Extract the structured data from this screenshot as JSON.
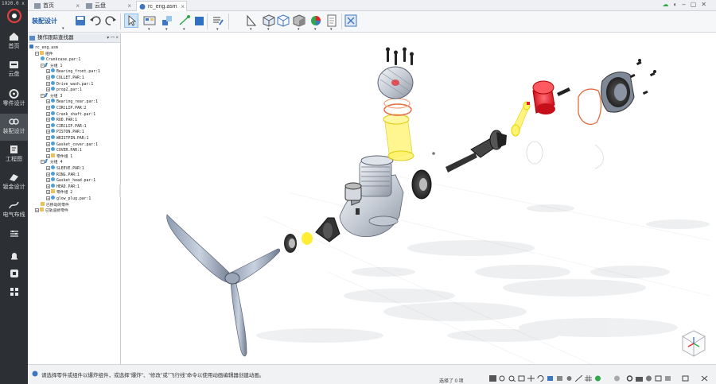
{
  "app": {
    "version": "1920.0 x 10",
    "rail": [
      {
        "label": "首页",
        "icon": "home-icon"
      },
      {
        "label": "云盘",
        "icon": "cloud-drive-icon"
      },
      {
        "label": "零件设计",
        "icon": "gear-icon"
      },
      {
        "label": "装配设计",
        "icon": "assembly-icon"
      },
      {
        "label": "工程图",
        "icon": "drawing-icon"
      },
      {
        "label": "钣金设计",
        "icon": "sheet-metal-icon"
      },
      {
        "label": "电气布线",
        "icon": "wiring-icon"
      }
    ]
  },
  "tabs": [
    {
      "label": "首页"
    },
    {
      "label": "云盘"
    },
    {
      "label": "rc_eng.asm"
    }
  ],
  "ribbon": {
    "mode": "装配设计"
  },
  "panel": {
    "title": "操作跟踪查找器",
    "controls": "▾ ꟷ ×"
  },
  "tree": [
    {
      "label": "rc_eng.asm",
      "depth": 0,
      "icon": "asm",
      "expander": ""
    },
    {
      "label": "组件",
      "depth": 1,
      "icon": "fol",
      "expander": "−"
    },
    {
      "label": "Crankcase.par:1",
      "depth": 2,
      "icon": "part",
      "expander": ""
    },
    {
      "label": "分组 1",
      "depth": 2,
      "icon": "grp",
      "expander": "−"
    },
    {
      "label": "Bearing_front.par:1",
      "depth": 3,
      "icon": "part",
      "expander": "+"
    },
    {
      "label": "COLLET.PAR:1",
      "depth": 3,
      "icon": "part",
      "expander": "+"
    },
    {
      "label": "Drive_wash.par:1",
      "depth": 3,
      "icon": "part",
      "expander": "+"
    },
    {
      "label": "prop2.par:1",
      "depth": 3,
      "icon": "part",
      "expander": "+"
    },
    {
      "label": "分组 3",
      "depth": 2,
      "icon": "grp",
      "expander": "−"
    },
    {
      "label": "Bearing_rear.par:1",
      "depth": 3,
      "icon": "part",
      "expander": "+"
    },
    {
      "label": "CIRCLIP.PAR:2",
      "depth": 3,
      "icon": "part",
      "expander": "+"
    },
    {
      "label": "Crank_shaft.par:1",
      "depth": 3,
      "icon": "part",
      "expander": "+"
    },
    {
      "label": "ROD.PAR:1",
      "depth": 3,
      "icon": "part",
      "expander": "+"
    },
    {
      "label": "CIRCLIP.PAR:1",
      "depth": 3,
      "icon": "part",
      "expander": "+"
    },
    {
      "label": "PISTON.PAR:1",
      "depth": 3,
      "icon": "part",
      "expander": "+"
    },
    {
      "label": "WRISTPIN.PAR:1",
      "depth": 3,
      "icon": "part",
      "expander": "+"
    },
    {
      "label": "Gasket_cover.par:1",
      "depth": 3,
      "icon": "part",
      "expander": "+"
    },
    {
      "label": "COVER.PAR:1",
      "depth": 3,
      "icon": "part",
      "expander": "+"
    },
    {
      "label": "零件组 1",
      "depth": 3,
      "icon": "fol",
      "expander": "+"
    },
    {
      "label": "分组 4",
      "depth": 2,
      "icon": "grp",
      "expander": "−"
    },
    {
      "label": "SLEEVE.PAR:1",
      "depth": 3,
      "icon": "part",
      "expander": "+"
    },
    {
      "label": "RING.PAR:1",
      "depth": 3,
      "icon": "part",
      "expander": "+"
    },
    {
      "label": "Gasket_head.par:1",
      "depth": 3,
      "icon": "part",
      "expander": "+"
    },
    {
      "label": "HEAD.PAR:1",
      "depth": 3,
      "icon": "part",
      "expander": "+"
    },
    {
      "label": "零件组 2",
      "depth": 3,
      "icon": "fol",
      "expander": "+"
    },
    {
      "label": "glow_plug.par:1",
      "depth": 3,
      "icon": "part",
      "expander": "+"
    },
    {
      "label": "已移动的零件",
      "depth": 2,
      "icon": "fol",
      "expander": ""
    },
    {
      "label": "已轨道修零件",
      "depth": 1,
      "icon": "fol",
      "expander": "+"
    }
  ],
  "status": {
    "message": "请选择零件或组件以爆炸组件，或选择\"爆炸\"、\"修改\"或\"飞行线\"命令以使用动画编辑器创建动画。",
    "selection": "选择了 0 项"
  },
  "colors": {
    "rail_bg": "#2c2f33",
    "accent": "#1f5fa8",
    "highlight_yellow": "#ffee33",
    "highlight_red": "#e8202a",
    "highlight_orange": "#f0883a"
  }
}
